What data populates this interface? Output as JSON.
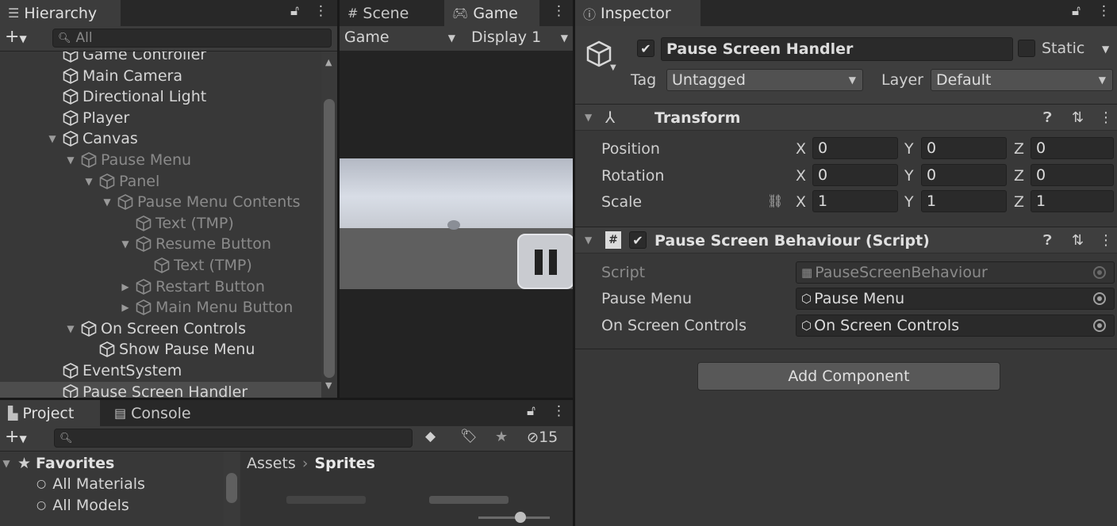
{
  "hierarchy": {
    "tab_label": "Hierarchy",
    "search_placeholder": "All",
    "items": [
      {
        "label": "Game Controller",
        "indent": 0,
        "dim": false,
        "arrow": ""
      },
      {
        "label": "Main Camera",
        "indent": 0,
        "dim": false,
        "arrow": ""
      },
      {
        "label": "Directional Light",
        "indent": 0,
        "dim": false,
        "arrow": ""
      },
      {
        "label": "Player",
        "indent": 0,
        "dim": false,
        "arrow": ""
      },
      {
        "label": "Canvas",
        "indent": 0,
        "dim": false,
        "arrow": "down"
      },
      {
        "label": "Pause Menu",
        "indent": 1,
        "dim": true,
        "arrow": "down"
      },
      {
        "label": "Panel",
        "indent": 2,
        "dim": true,
        "arrow": "down"
      },
      {
        "label": "Pause Menu Contents",
        "indent": 3,
        "dim": true,
        "arrow": "down"
      },
      {
        "label": "Text (TMP)",
        "indent": 4,
        "dim": true,
        "arrow": ""
      },
      {
        "label": "Resume Button",
        "indent": 4,
        "dim": true,
        "arrow": "down"
      },
      {
        "label": "Text (TMP)",
        "indent": 5,
        "dim": true,
        "arrow": ""
      },
      {
        "label": "Restart Button",
        "indent": 4,
        "dim": true,
        "arrow": "right"
      },
      {
        "label": "Main Menu Button",
        "indent": 4,
        "dim": true,
        "arrow": "right"
      },
      {
        "label": "On Screen Controls",
        "indent": 1,
        "dim": false,
        "arrow": "down"
      },
      {
        "label": "Show Pause Menu",
        "indent": 2,
        "dim": false,
        "arrow": ""
      },
      {
        "label": "EventSystem",
        "indent": 0,
        "dim": false,
        "arrow": ""
      },
      {
        "label": "Pause Screen Handler",
        "indent": 0,
        "dim": false,
        "arrow": "",
        "selected": true
      }
    ]
  },
  "game": {
    "scene_tab": "Scene",
    "game_tab": "Game",
    "view_dropdown": "Game",
    "display_dropdown": "Display 1"
  },
  "project": {
    "project_tab": "Project",
    "console_tab": "Console",
    "hidden_count": "15",
    "favorites_label": "Favorites",
    "favorites": [
      "All Materials",
      "All Models"
    ],
    "breadcrumb_root": "Assets",
    "breadcrumb_current": "Sprites"
  },
  "inspector": {
    "tab_label": "Inspector",
    "object_name": "Pause Screen Handler",
    "static_label": "Static",
    "tag_label": "Tag",
    "tag_value": "Untagged",
    "layer_label": "Layer",
    "layer_value": "Default",
    "transform": {
      "title": "Transform",
      "rows": [
        {
          "label": "Position",
          "x": "0",
          "y": "0",
          "z": "0"
        },
        {
          "label": "Rotation",
          "x": "0",
          "y": "0",
          "z": "0"
        },
        {
          "label": "Scale",
          "x": "1",
          "y": "1",
          "z": "1"
        }
      ],
      "axis_x": "X",
      "axis_y": "Y",
      "axis_z": "Z"
    },
    "script_component": {
      "title": "Pause Screen Behaviour (Script)",
      "script_label": "Script",
      "script_value": "PauseScreenBehaviour",
      "pause_menu_label": "Pause Menu",
      "pause_menu_value": "Pause Menu",
      "on_screen_label": "On Screen Controls",
      "on_screen_value": "On Screen Controls"
    },
    "add_component": "Add Component"
  }
}
